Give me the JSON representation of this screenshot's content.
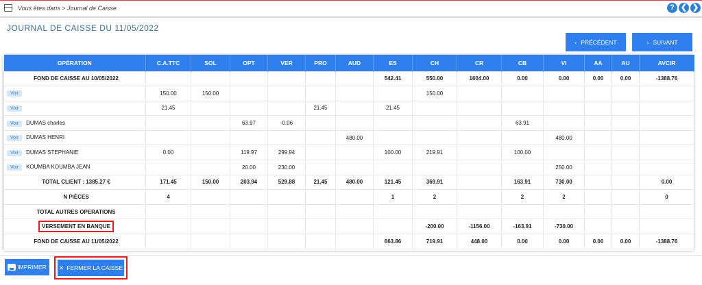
{
  "breadcrumb": "Vous êtes dans > Journal de Caisse",
  "top_icons": [
    {
      "name": "help-icon",
      "glyph": "?"
    },
    {
      "name": "back-icon",
      "glyph": "❮"
    },
    {
      "name": "forward-icon",
      "glyph": "❯"
    }
  ],
  "page_title": "JOURNAL DE CAISSE DU 11/05/2022",
  "nav": {
    "prev_label": "PRÉCÉDENT",
    "next_label": "SUIVANT"
  },
  "table": {
    "headers": [
      "OPÉRATION",
      "C.A.TTC",
      "SOL",
      "OPT",
      "VER",
      "PRO",
      "AUD",
      "ES",
      "CH",
      "CR",
      "CB",
      "VI",
      "AA",
      "AU",
      "AVCIR"
    ],
    "rows": [
      {
        "type": "bold",
        "voir": "",
        "op": "FOND DE CAISSE AU 10/05/2022",
        "cells": [
          "",
          "",
          "",
          "",
          "",
          "",
          "542.41",
          "550.00",
          "1604.00",
          "0.00",
          "0.00",
          "0.00",
          "0.00",
          "-1388.76"
        ]
      },
      {
        "type": "normal",
        "voir": "Voir",
        "op": "",
        "cells": [
          "150.00",
          "150.00",
          "",
          "",
          "",
          "",
          "",
          "150.00",
          "",
          "",
          "",
          "",
          "",
          ""
        ]
      },
      {
        "type": "normal",
        "voir": "Voir",
        "op": "",
        "cells": [
          "21.45",
          "",
          "",
          "",
          "21.45",
          "",
          "21.45",
          "",
          "",
          "",
          "",
          "",
          "",
          ""
        ]
      },
      {
        "type": "normal",
        "voir": "Voir",
        "op": "DUMAS charles",
        "cells": [
          "",
          "",
          "63.97",
          "-0.06",
          "",
          "",
          "",
          "",
          "",
          "63.91",
          "",
          "",
          "",
          ""
        ]
      },
      {
        "type": "normal",
        "voir": "Voir",
        "op": "DUMAS HENRI",
        "cells": [
          "",
          "",
          "",
          "",
          "",
          "480.00",
          "",
          "",
          "",
          "",
          "480.00",
          "",
          "",
          ""
        ]
      },
      {
        "type": "normal",
        "voir": "Voir",
        "op": "DUMAS STEPHANIE",
        "cells": [
          "0.00",
          "",
          "119.97",
          "299.94",
          "",
          "",
          "100.00",
          "219.91",
          "",
          "100.00",
          "",
          "",
          "",
          ""
        ]
      },
      {
        "type": "normal",
        "voir": "Voir",
        "op": "KOUMBA KOUMBA JEAN",
        "cells": [
          "",
          "",
          "20.00",
          "230.00",
          "",
          "",
          "",
          "",
          "",
          "",
          "250.00",
          "",
          "",
          ""
        ]
      },
      {
        "type": "bold",
        "voir": "",
        "op": "TOTAL CLIENT : 1385.27 €",
        "cells": [
          "171.45",
          "150.00",
          "203.94",
          "529.88",
          "21.45",
          "480.00",
          "121.45",
          "369.91",
          "",
          "163.91",
          "730.00",
          "",
          "",
          "0.00"
        ]
      },
      {
        "type": "bold",
        "voir": "",
        "op": "N PIÈCES",
        "cells": [
          "4",
          "",
          "",
          "",
          "",
          "",
          "1",
          "2",
          "",
          "2",
          "2",
          "",
          "",
          "0"
        ]
      },
      {
        "type": "bold",
        "voir": "",
        "op": "TOTAL AUTRES OPERATIONS",
        "cells": [
          "",
          "",
          "",
          "",
          "",
          "",
          "",
          "",
          "",
          "",
          "",
          "",
          "",
          ""
        ]
      },
      {
        "type": "versement",
        "voir": "",
        "op": "VERSEMENT EN BANQUE",
        "cells": [
          "",
          "",
          "",
          "",
          "",
          "",
          "",
          "-200.00",
          "-1156.00",
          "-163.91",
          "-730.00",
          "",
          "",
          ""
        ]
      },
      {
        "type": "bold",
        "voir": "",
        "op": "FOND DE CAISSE AU 11/05/2022",
        "cells": [
          "",
          "",
          "",
          "",
          "",
          "",
          "663.86",
          "719.91",
          "448.00",
          "0.00",
          "0.00",
          "0.00",
          "0.00",
          "-1388.76"
        ]
      }
    ]
  },
  "actions": {
    "print_label": "IMPRIMER",
    "close_label": "FERMER LA CAISSE"
  },
  "colors": {
    "primary": "#2f80ee",
    "highlight": "#e02020",
    "title": "#3a6f9a"
  }
}
